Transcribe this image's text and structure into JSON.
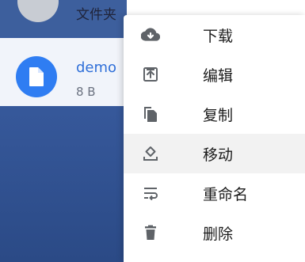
{
  "file_list": {
    "folder_row": {
      "label": "文件夹"
    },
    "file_row": {
      "name": "demo",
      "size": "8 B",
      "icon": "file-icon"
    }
  },
  "context_menu": {
    "items": [
      {
        "label": "下载",
        "icon": "cloud-download-icon"
      },
      {
        "label": "编辑",
        "icon": "edit-upload-icon"
      },
      {
        "label": "复制",
        "icon": "copy-icon"
      },
      {
        "label": "移动",
        "icon": "move-icon",
        "hovered": true
      },
      {
        "label": "重命名",
        "icon": "rename-wrap-icon"
      },
      {
        "label": "删除",
        "icon": "trash-icon"
      }
    ]
  },
  "colors": {
    "accent": "#2f7df2",
    "sidebar": "#36589a",
    "menu_hover": "#f2f2f2",
    "icon": "#5f6368"
  }
}
